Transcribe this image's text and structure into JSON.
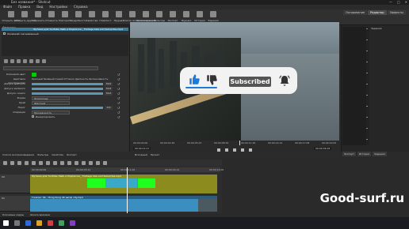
{
  "window": {
    "title": "Без названия* - Shotcut"
  },
  "menu": [
    "Файл",
    "Правка",
    "Вид",
    "Настройки",
    "Справка"
  ],
  "toolbar": [
    {
      "label": "Открыть файл",
      "icon": "open-file-icon"
    },
    {
      "label": "Открыть другой",
      "icon": "open-other-icon"
    },
    {
      "label": "Сохранить",
      "icon": "save-icon"
    },
    {
      "label": "Отменить",
      "icon": "undo-icon"
    },
    {
      "label": "Повторить",
      "icon": "redo-icon"
    },
    {
      "label": "Подробности",
      "icon": "info-icon"
    },
    {
      "label": "Свойства",
      "icon": "properties-icon"
    },
    {
      "label": "Плейлист",
      "icon": "playlist-icon"
    },
    {
      "label": "Журнал",
      "icon": "history-icon"
    },
    {
      "label": "Список воспроизведения",
      "icon": "list-icon"
    },
    {
      "label": "Шкала времени",
      "icon": "timeline-icon"
    },
    {
      "label": "Фильтры",
      "icon": "filters-icon"
    },
    {
      "label": "Экспорт",
      "icon": "export-icon"
    },
    {
      "label": "Журнал",
      "icon": "log-icon"
    },
    {
      "label": "История",
      "icon": "history2-icon"
    },
    {
      "label": "Задания",
      "icon": "jobs-icon"
    }
  ],
  "modes": [
    "Логирование",
    "Редактор",
    "Эффекты"
  ],
  "filters": {
    "title": "Фильтры",
    "file": "Футажи для YouTube Лайк и Подписка _ Footage Like and Subscribe.mp4",
    "item": "Хромакей: расширенный",
    "preset_label": "",
    "rows": [
      {
        "label": "Ключевой цвет",
        "type": "color"
      },
      {
        "label": "Цветовое пространство",
        "type": "radio",
        "text": "Красный Зелёный Синий    Оттенок Цветность Интенсивность"
      },
      {
        "label": "Допуск красного",
        "type": "slider",
        "value": "30.0"
      },
      {
        "label": "Допуск зелёного",
        "type": "slider",
        "value": "30.0"
      },
      {
        "label": "Допуск синего",
        "type": "slider",
        "value": "30.0"
      },
      {
        "label": "Форма",
        "type": "dropdown",
        "value": "Эллипсоид"
      },
      {
        "label": "Край",
        "type": "dropdown",
        "value": "Жёсткий"
      },
      {
        "label": "Порог",
        "type": "slider",
        "value": "0.0"
      },
      {
        "label": "Операция",
        "type": "dropdown",
        "value": "Прозрачность"
      },
      {
        "label": "",
        "type": "check",
        "value": "Инвертировать"
      }
    ]
  },
  "overlay": {
    "subscribed": "Subscribed",
    "accent": "#1e7ad8"
  },
  "scrubber": {
    "times": [
      "00:00:00:00",
      "00:00:02:26",
      "00:00:05:23",
      "00:00:08:19",
      "00:00:11:16",
      "00:00:14:12",
      "00:00:17:08",
      "00:00:20:05"
    ],
    "tc_current": "00:00:12:17",
    "tc_total": "00:00:36:18"
  },
  "right_panel": {
    "ruler": [
      "0",
      "-5",
      "-10",
      "-15",
      "-20",
      "-25",
      "-30",
      "-35",
      "-40",
      "-45",
      "-50"
    ],
    "tabs": [
      "Файлы",
      "Плейлист",
      "Фильтры",
      "Свойства"
    ],
    "tabs2": [
      "Экспорт",
      "История",
      "Задания"
    ],
    "col_head": "Задания"
  },
  "mid_tabs_left": [
    "Список воспроизведения",
    "Фильтры",
    "Свойства",
    "Экспорт"
  ],
  "mid_tabs_right": [
    "Исходный",
    "Проект"
  ],
  "timeline": {
    "ruler": [
      "00:00:00:00",
      "00:00:05:12",
      "00:00:11:00",
      "00:00:16:12",
      "00:00:22:00"
    ],
    "tracks": [
      {
        "name": "V2",
        "clip": "Футажи для YouTube Лайк и Подписка _ Footage Like and Subscribe.mp4"
      },
      {
        "name": "V1",
        "clip": "Гонконг 4K - Hong Kong 4K aerial city.mp4"
      }
    ],
    "tabs": [
      "Ключевые кадры",
      "Шкала времени"
    ]
  },
  "watermark": "Good-surf.ru"
}
